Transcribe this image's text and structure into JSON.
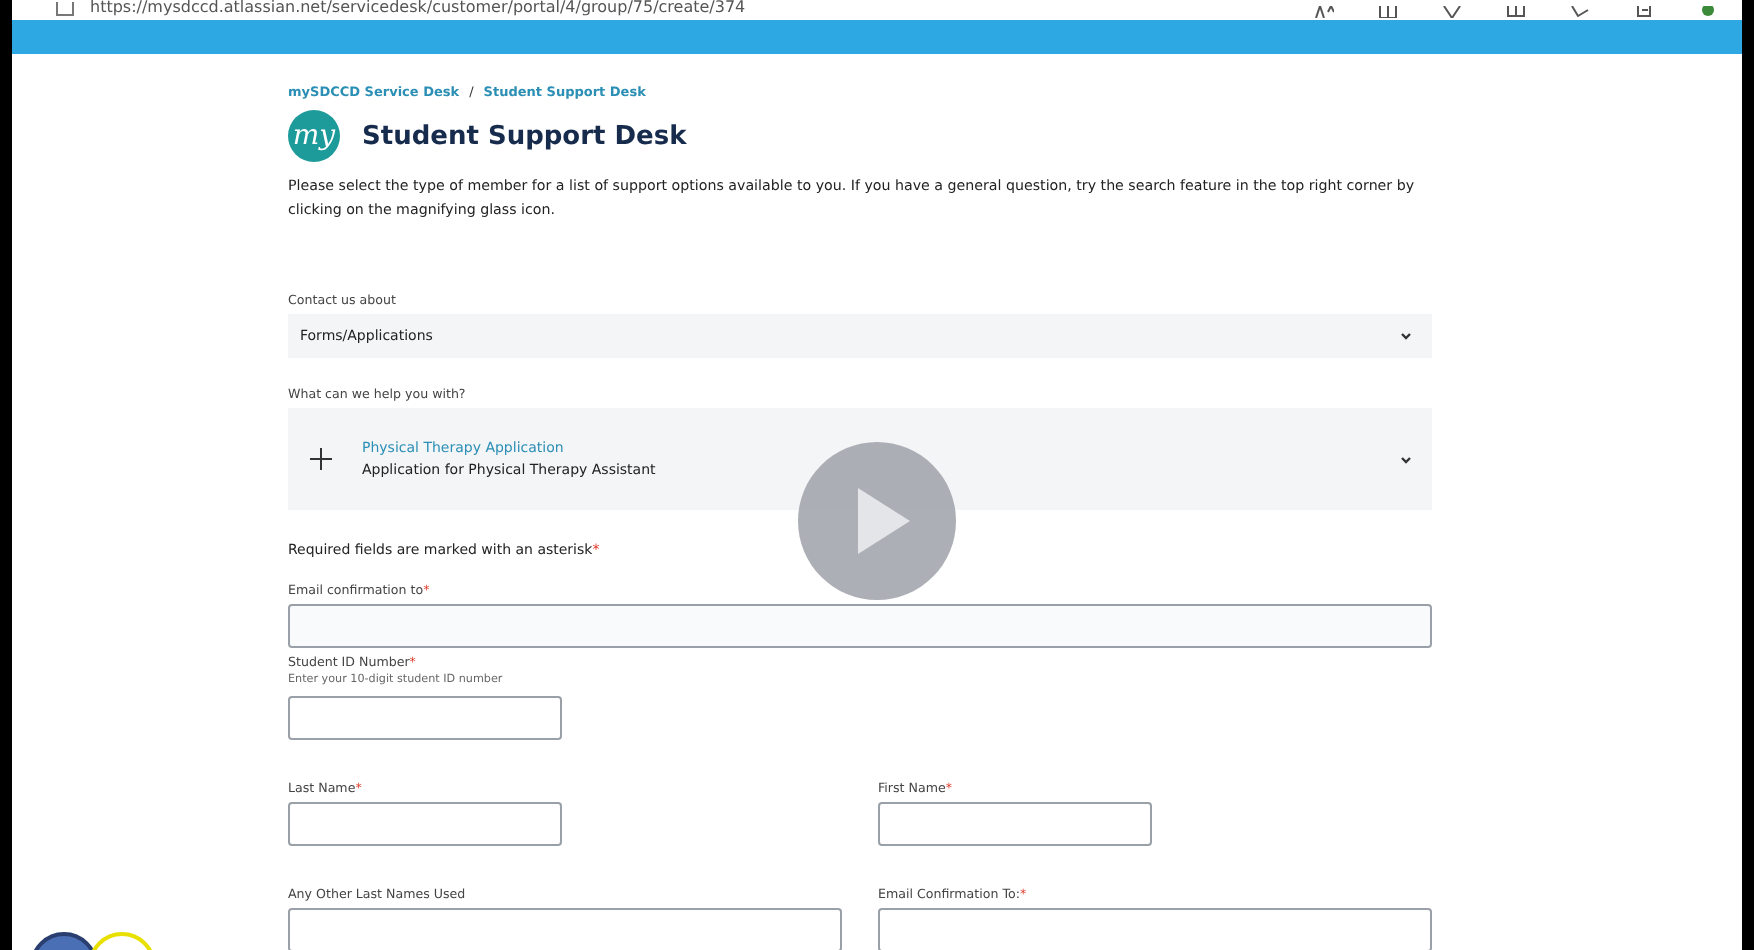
{
  "browser": {
    "url": "https://mysdccd.atlassian.net/servicedesk/customer/portal/4/group/75/create/374"
  },
  "breadcrumbs": [
    {
      "label": "mySDCCD Service Desk"
    },
    {
      "label": "Student Support Desk"
    }
  ],
  "breadcrumb_separator": "/",
  "logo": {
    "text": "my"
  },
  "title": "Student Support Desk",
  "intro": "Please select the type of member for a list of support options available to you. If you have a general question, try the search feature in the top right corner by clicking on the magnifying glass icon.",
  "form": {
    "rows": [
      [
        {
          "kind": "select",
          "label": "Contact us about",
          "value": "Forms/Applications"
        }
      ],
      [
        {
          "kind": "request-type",
          "label": "What can we help you with?",
          "name": "Physical Therapy Application",
          "description": "Application for Physical Therapy Assistant"
        }
      ],
      [
        {
          "kind": "note",
          "label": "Required fields are marked with an asterisk",
          "marker": "*"
        }
      ],
      [
        {
          "kind": "text-wide",
          "label": "Email confirmation to",
          "marker": "*"
        }
      ],
      [
        {
          "kind": "text-short",
          "label": "Student ID Number",
          "marker": "*",
          "hint": "Enter your 10-digit student ID number"
        }
      ],
      [
        {
          "kind": "text-short",
          "label": "Last Name",
          "marker": "*"
        },
        {
          "kind": "text-short",
          "label": "First Name",
          "marker": "*"
        }
      ],
      [
        {
          "kind": "text-wide-cut",
          "label": "Any Other Last Names Used"
        },
        {
          "kind": "text-wide-cut",
          "label": "Email Confirmation To:",
          "marker": "*"
        }
      ]
    ]
  },
  "video_overlay": {
    "play_button": true
  }
}
